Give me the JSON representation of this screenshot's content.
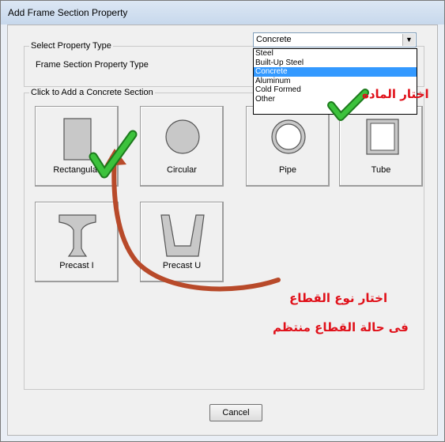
{
  "window": {
    "title": "Add Frame Section Property"
  },
  "property_type_group": {
    "title": "Select Property Type",
    "field_label": "Frame Section Property Type",
    "selected": "Concrete",
    "options": [
      "Steel",
      "Built-Up Steel",
      "Concrete",
      "Aluminum",
      "Cold Formed",
      "Other"
    ]
  },
  "sections_group": {
    "title": "Click to Add a Concrete Section",
    "tiles": [
      {
        "label": "Rectangular"
      },
      {
        "label": "Circular"
      },
      {
        "label": "Pipe"
      },
      {
        "label": "Tube"
      },
      {
        "label": "Precast I"
      },
      {
        "label": "Precast U"
      }
    ]
  },
  "buttons": {
    "cancel": "Cancel"
  },
  "annotations": {
    "material_note": "اختار الماده",
    "section_note_line1": "اختار نوع القطاع",
    "section_note_line2": "فى حالة القطاع منتظم"
  },
  "colors": {
    "annotation": "#e0111a",
    "check": "#2fa52f",
    "arrow": "#b84a2a",
    "selection": "#3399ff"
  }
}
